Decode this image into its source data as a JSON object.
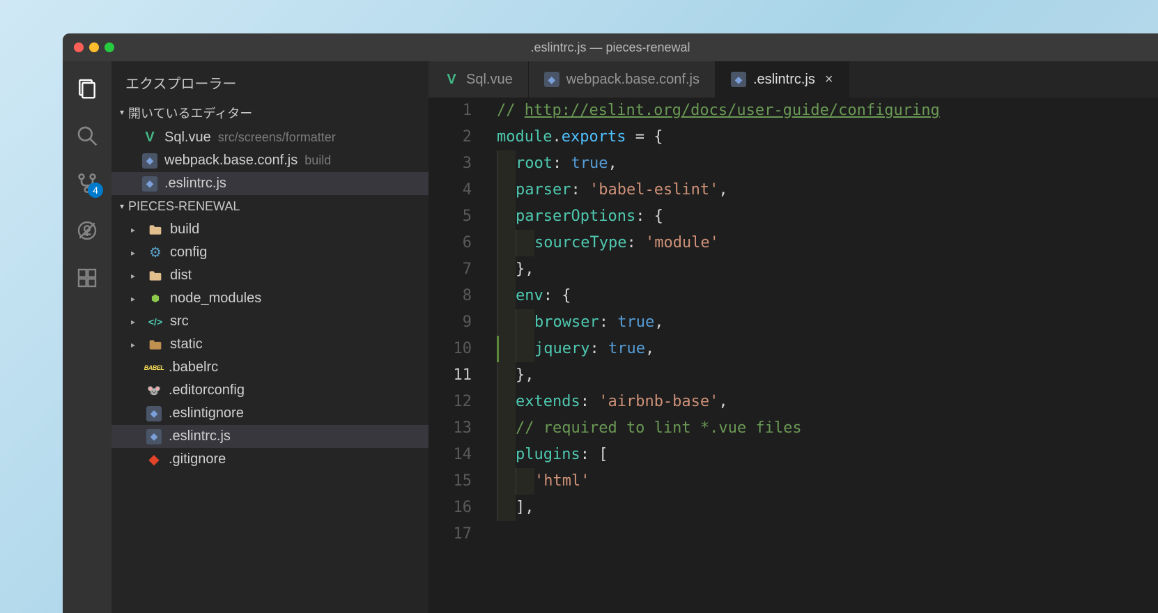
{
  "window": {
    "title": ".eslintrc.js — pieces-renewal"
  },
  "activityBar": {
    "badge": "4"
  },
  "sidebar": {
    "title": "エクスプローラー",
    "openEditors": {
      "label": "開いているエディター",
      "items": [
        {
          "name": "Sql.vue",
          "path": "src/screens/formatter"
        },
        {
          "name": "webpack.base.conf.js",
          "path": "build"
        },
        {
          "name": ".eslintrc.js",
          "path": ""
        }
      ]
    },
    "workspace": {
      "label": "PIECES-RENEWAL",
      "folders": [
        {
          "name": "build"
        },
        {
          "name": "config"
        },
        {
          "name": "dist"
        },
        {
          "name": "node_modules"
        },
        {
          "name": "src"
        },
        {
          "name": "static"
        }
      ],
      "files": [
        {
          "name": ".babelrc",
          "icon": "babel"
        },
        {
          "name": ".editorconfig",
          "icon": "editor"
        },
        {
          "name": ".eslintignore",
          "icon": "js"
        },
        {
          "name": ".eslintrc.js",
          "icon": "js",
          "active": true
        },
        {
          "name": ".gitignore",
          "icon": "git"
        }
      ]
    }
  },
  "tabs": [
    {
      "label": "Sql.vue",
      "icon": "vue"
    },
    {
      "label": "webpack.base.conf.js",
      "icon": "js"
    },
    {
      "label": ".eslintrc.js",
      "icon": "js",
      "active": true
    }
  ],
  "editor": {
    "lineStart": 1,
    "lineEnd": 17,
    "url": "http://eslint.org/docs/user-guide/configuring"
  }
}
